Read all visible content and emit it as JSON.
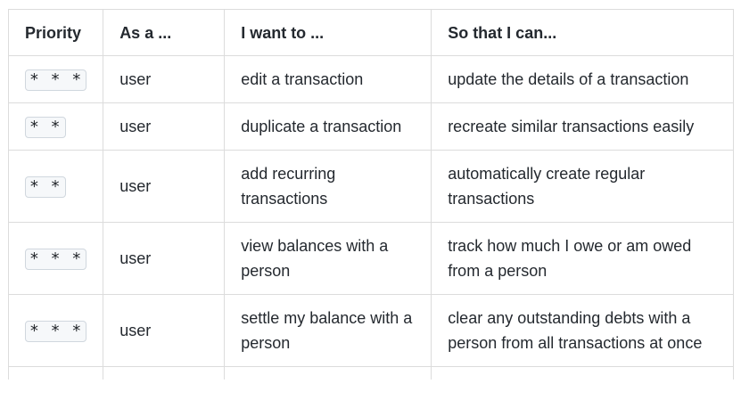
{
  "table": {
    "headers": {
      "priority": "Priority",
      "as_a": "As a ...",
      "want": "I want to ...",
      "so_that": "So that I can..."
    },
    "rows": [
      {
        "priority": "* * *",
        "as_a": "user",
        "want": "edit a transaction",
        "so_that": "update the details of a transaction"
      },
      {
        "priority": "* *",
        "as_a": "user",
        "want": "duplicate a transaction",
        "so_that": "recreate similar transactions easily"
      },
      {
        "priority": "* *",
        "as_a": "user",
        "want": "add recurring transactions",
        "so_that": "automatically create regular transactions"
      },
      {
        "priority": "* * *",
        "as_a": "user",
        "want": "view balances with a person",
        "so_that": "track how much I owe or am owed from a person"
      },
      {
        "priority": "* * *",
        "as_a": "user",
        "want": "settle my balance with a person",
        "so_that": "clear any outstanding debts with a person from all transactions at once"
      }
    ]
  }
}
